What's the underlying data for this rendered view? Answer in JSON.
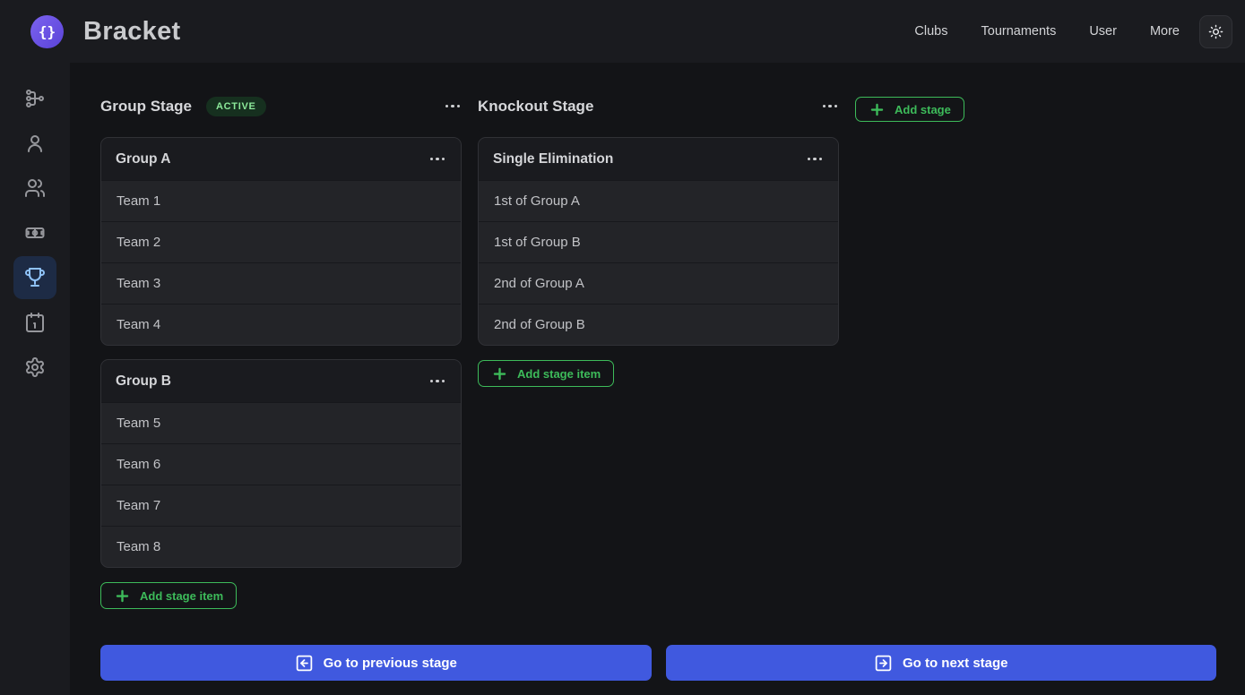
{
  "brand": {
    "title": "Bracket",
    "logo_glyph": "{}"
  },
  "nav": [
    {
      "label": "Clubs"
    },
    {
      "label": "Tournaments"
    },
    {
      "label": "User"
    },
    {
      "label": "More"
    }
  ],
  "theme_toggle": {
    "icon": "sun-icon"
  },
  "sidebar": {
    "items": [
      {
        "icon": "network-icon",
        "active": false
      },
      {
        "icon": "user-icon",
        "active": false
      },
      {
        "icon": "users-icon",
        "active": false
      },
      {
        "icon": "field-icon",
        "active": false
      },
      {
        "icon": "trophy-icon",
        "active": true
      },
      {
        "icon": "calendar-icon",
        "active": false
      },
      {
        "icon": "gear-icon",
        "active": false
      }
    ]
  },
  "group_stage": {
    "title": "Group Stage",
    "badge": "ACTIVE",
    "groups": [
      {
        "title": "Group A",
        "teams": [
          "Team 1",
          "Team 2",
          "Team 3",
          "Team 4"
        ]
      },
      {
        "title": "Group B",
        "teams": [
          "Team 5",
          "Team 6",
          "Team 7",
          "Team 8"
        ]
      }
    ],
    "add_item_label": "Add stage item"
  },
  "knockout_stage": {
    "title": "Knockout Stage",
    "brackets": [
      {
        "title": "Single Elimination",
        "slots": [
          "1st of Group A",
          "1st of Group B",
          "2nd of Group A",
          "2nd of Group B"
        ]
      }
    ],
    "add_item_label": "Add stage item"
  },
  "actions": {
    "add_stage": "Add stage",
    "prev_stage": "Go to previous stage",
    "next_stage": "Go to next stage"
  },
  "colors": {
    "accent_green": "#3dbb5a",
    "accent_blue": "#4059df",
    "brand_purple": "#6a54e0",
    "badge_bg": "#16301f",
    "badge_text": "#8ce99a",
    "sidebar_active_bg": "#1d2b45",
    "sidebar_active_icon": "#8fc2f8",
    "topbar_bg": "#1a1b1f",
    "page_bg": "#131417",
    "card_row_bg": "#232428"
  }
}
